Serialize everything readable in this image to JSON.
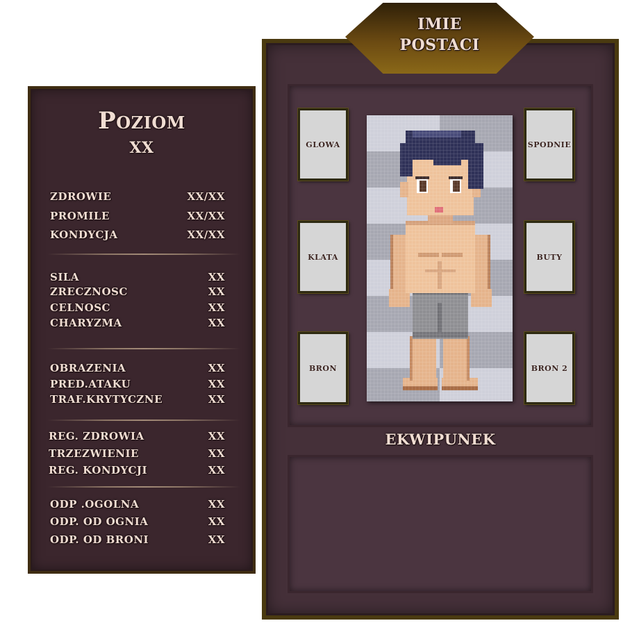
{
  "stats_panel": {
    "title": "Poziom",
    "level": "XX",
    "groups": [
      [
        {
          "label": "ZDROWIE",
          "value": "XX/XX"
        },
        {
          "label": "PROMILE",
          "value": "XX/XX"
        },
        {
          "label": "KONDYCJA",
          "value": "XX/XX"
        }
      ],
      [
        {
          "label": "SILA",
          "value": "XX"
        },
        {
          "label": "ZRECZNOSC",
          "value": "XX"
        },
        {
          "label": "CELNOSC",
          "value": "XX"
        },
        {
          "label": "CHARYZMA",
          "value": "XX"
        }
      ],
      [
        {
          "label": "OBRAZENIA",
          "value": "XX"
        },
        {
          "label": "PRED.ATAKU",
          "value": "XX"
        },
        {
          "label": "TRAF.KRYTYCZNE",
          "value": "XX"
        }
      ],
      [
        {
          "label": "REG. ZDROWIA",
          "value": "XX"
        },
        {
          "label": "TRZEZWIENIE",
          "value": "XX"
        },
        {
          "label": "REG. KONDYCJI",
          "value": "XX"
        }
      ],
      [
        {
          "label": "ODP .OGOLNA",
          "value": "XX"
        },
        {
          "label": "ODP. OD OGNIA",
          "value": "XX"
        },
        {
          "label": "ODP. OD BRONI",
          "value": "XX"
        }
      ]
    ]
  },
  "character": {
    "name_line1": "IMIE",
    "name_line2": "POSTACI",
    "slots": {
      "glowa": "GLOWA",
      "klata": "KLATA",
      "bron": "BRON",
      "spodnie": "SPODNIE",
      "buty": "BUTY",
      "bron2": "BRON 2"
    }
  },
  "inventory": {
    "title": "EKWIPUNEK"
  },
  "colors": {
    "panel": "#3b262d",
    "panel_right": "#453039",
    "gold_frame": "#4a3a10",
    "text": "#f0ddd2",
    "slot_bg": "#d6d6d6"
  }
}
